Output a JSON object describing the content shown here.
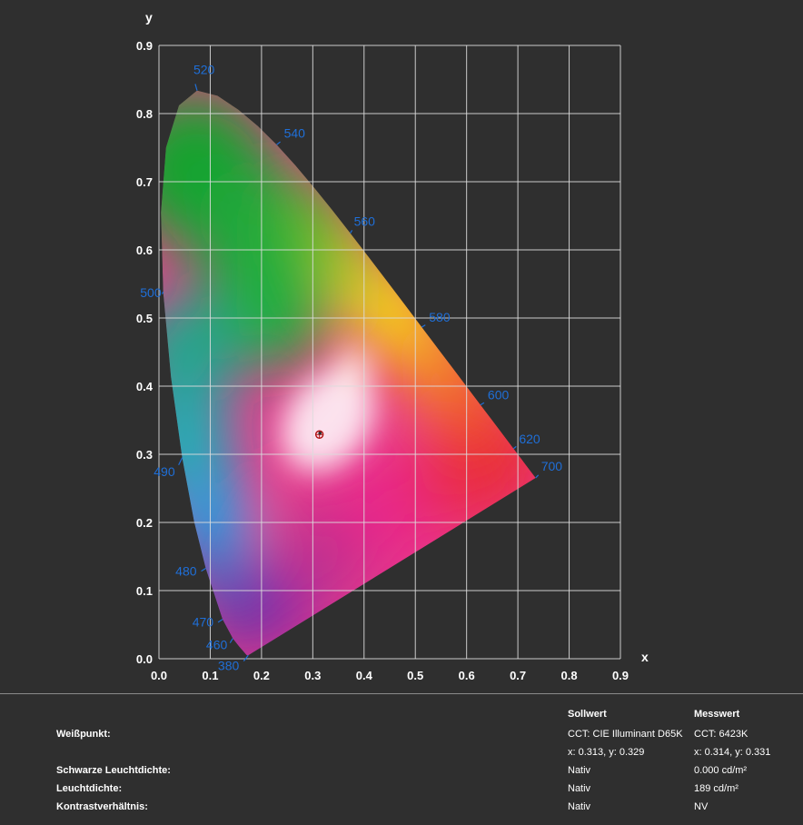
{
  "chart_data": {
    "type": "scatter",
    "xlabel": "x",
    "ylabel": "y",
    "xlim": [
      0.0,
      0.9
    ],
    "ylim": [
      0.0,
      0.9
    ],
    "x_ticks": [
      "0.0",
      "0.1",
      "0.2",
      "0.3",
      "0.4",
      "0.5",
      "0.6",
      "0.7",
      "0.8",
      "0.9"
    ],
    "y_ticks": [
      "0.0",
      "0.1",
      "0.2",
      "0.3",
      "0.4",
      "0.5",
      "0.6",
      "0.7",
      "0.8",
      "0.9"
    ],
    "grid": true,
    "wavelength_labels": [
      {
        "text": "380",
        "x": 0.1741,
        "y": 0.005
      },
      {
        "text": "460",
        "x": 0.144,
        "y": 0.0297
      },
      {
        "text": "470",
        "x": 0.1241,
        "y": 0.0578
      },
      {
        "text": "480",
        "x": 0.0913,
        "y": 0.1327
      },
      {
        "text": "490",
        "x": 0.0454,
        "y": 0.295
      },
      {
        "text": "500",
        "x": 0.0082,
        "y": 0.5384
      },
      {
        "text": "520",
        "x": 0.0743,
        "y": 0.8338
      },
      {
        "text": "540",
        "x": 0.2296,
        "y": 0.7543
      },
      {
        "text": "560",
        "x": 0.3731,
        "y": 0.6245
      },
      {
        "text": "580",
        "x": 0.5125,
        "y": 0.4866
      },
      {
        "text": "600",
        "x": 0.627,
        "y": 0.3725
      },
      {
        "text": "620",
        "x": 0.6915,
        "y": 0.3083
      },
      {
        "text": "700",
        "x": 0.7347,
        "y": 0.2653
      }
    ],
    "points": [
      {
        "name": "Sollwert",
        "x": 0.313,
        "y": 0.329
      },
      {
        "name": "Messwert",
        "x": 0.314,
        "y": 0.331
      }
    ]
  },
  "table": {
    "headers": {
      "target": "Sollwert",
      "measured": "Messwert"
    },
    "rows": [
      {
        "label": "Weißpunkt:",
        "target": "CCT: CIE Illuminant D65K",
        "measured": "CCT: 6423K"
      },
      {
        "label": "",
        "target": "x: 0.313, y: 0.329",
        "measured": "x: 0.314, y: 0.331"
      },
      {
        "label": "Schwarze Leuchtdichte:",
        "target": "Nativ",
        "measured": "0.000 cd/m²"
      },
      {
        "label": "Leuchtdichte:",
        "target": "Nativ",
        "measured": "189 cd/m²"
      },
      {
        "label": "Kontrastverhältnis:",
        "target": "Nativ",
        "measured": "NV"
      }
    ]
  }
}
